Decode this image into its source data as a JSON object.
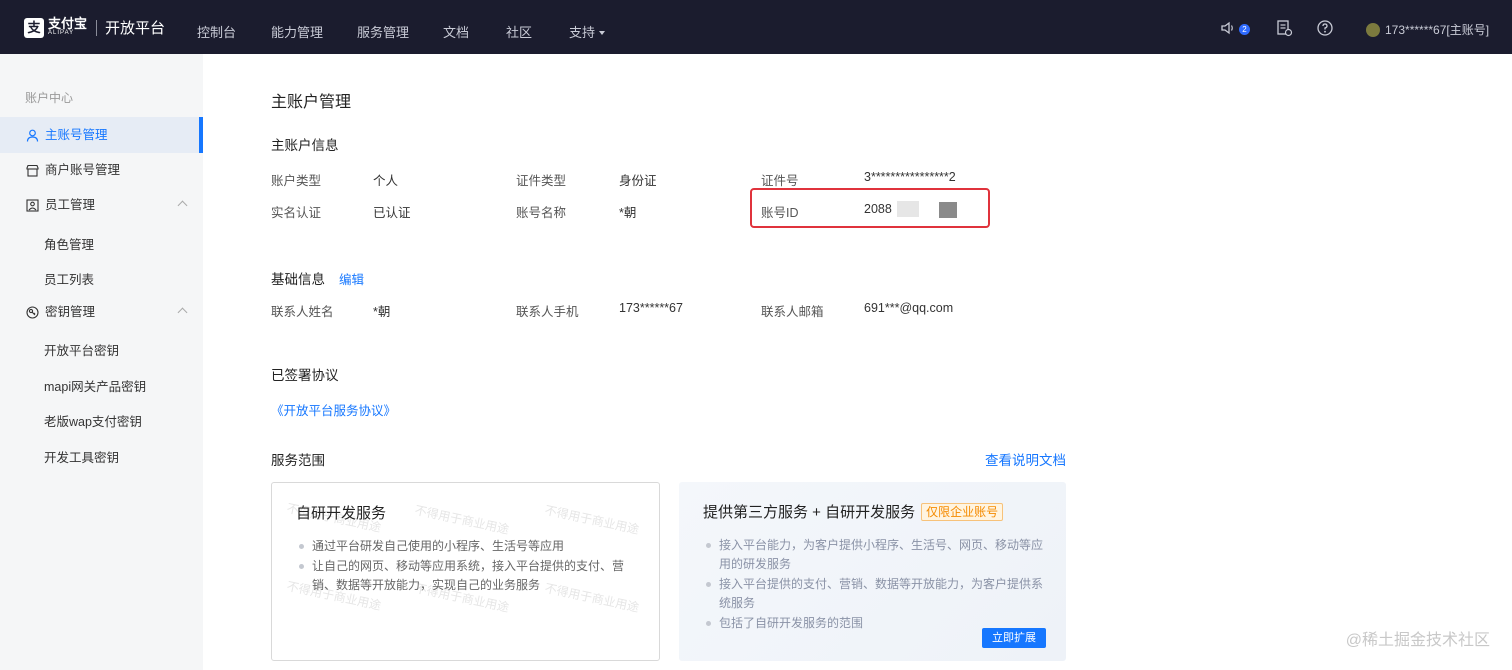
{
  "header": {
    "logo_mark": "支",
    "logo_text": "支付宝",
    "logo_sub": "ALIPAY",
    "platform": "开放平台",
    "nav": [
      "控制台",
      "能力管理",
      "服务管理",
      "文档",
      "社区",
      "支持"
    ],
    "notification_count": "2",
    "user": "173******67[主账号]"
  },
  "sidebar": {
    "section": "账户中心",
    "items": [
      {
        "label": "主账号管理"
      },
      {
        "label": "商户账号管理"
      },
      {
        "label": "员工管理"
      },
      {
        "label": "角色管理"
      },
      {
        "label": "员工列表"
      },
      {
        "label": "密钥管理"
      },
      {
        "label": "开放平台密钥"
      },
      {
        "label": "mapi网关产品密钥"
      },
      {
        "label": "老版wap支付密钥"
      },
      {
        "label": "开发工具密钥"
      }
    ]
  },
  "main": {
    "title": "主账户管理",
    "account_info": {
      "title": "主账户信息",
      "rows": [
        [
          {
            "label": "账户类型",
            "value": "个人"
          },
          {
            "label": "证件类型",
            "value": "身份证"
          },
          {
            "label": "证件号",
            "value": "3****************2"
          }
        ],
        [
          {
            "label": "实名认证",
            "value": "已认证"
          },
          {
            "label": "账号名称",
            "value": "*朝"
          },
          {
            "label": "账号ID",
            "value": "2088"
          }
        ]
      ]
    },
    "basic_info": {
      "title": "基础信息",
      "edit": "编辑",
      "fields": [
        {
          "label": "联系人姓名",
          "value": "*朝"
        },
        {
          "label": "联系人手机",
          "value": "173******67"
        },
        {
          "label": "联系人邮箱",
          "value": "691***@qq.com"
        }
      ]
    },
    "agreements": {
      "title": "已签署协议",
      "link": "《开放平台服务协议》"
    },
    "service_scope": {
      "title": "服务范围",
      "doc_link": "查看说明文档",
      "card1": {
        "title": "自研开发服务",
        "bullets": [
          "通过平台研发自己使用的小程序、生活号等应用",
          "让自己的网页、移动等应用系统，接入平台提供的支付、营销、数据等开放能力，实现自己的业务服务"
        ]
      },
      "card2": {
        "title": "提供第三方服务 + 自研开发服务",
        "tag": "仅限企业账号",
        "bullets": [
          "接入平台能力，为客户提供小程序、生活号、网页、移动等应用的研发服务",
          "接入平台提供的支付、营销、数据等开放能力，为客户提供系统服务",
          "包括了自研开发服务的范围"
        ],
        "button": "立即扩展"
      },
      "watermark": "不得用于商业用途"
    }
  },
  "corner_watermark": "@稀土掘金技术社区",
  "colors": {
    "topbar": "#1b1c2e",
    "accent": "#1677ff",
    "highlight": "#e0333c",
    "tag": "#f58b00"
  }
}
